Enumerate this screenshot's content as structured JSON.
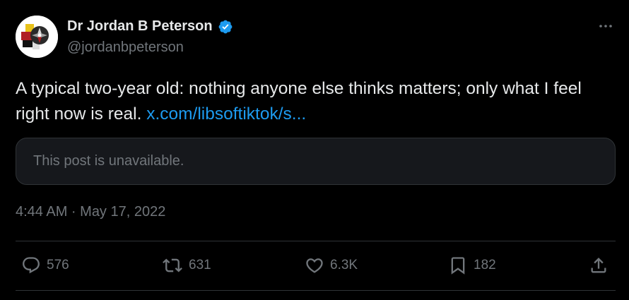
{
  "colors": {
    "background": "#000000",
    "text_primary": "#e7e9ea",
    "text_secondary": "#71767b",
    "link": "#1d9bf0",
    "verified_badge": "#1d9bf0",
    "divider": "#2f3336",
    "quote_background": "#16181c"
  },
  "author": {
    "display_name": "Dr Jordan B Peterson",
    "handle": "@jordanbpeterson",
    "verified_icon": "verified-badge-icon",
    "avatar": "profile-avatar-image"
  },
  "header": {
    "more_icon": "more-horizontal-icon"
  },
  "post": {
    "text": "A typical two-year old: nothing anyone else thinks matters; only what I feel right now is real. ",
    "link_text": "x.com/libsoftiktok/s..."
  },
  "quote": {
    "text": "This post is unavailable."
  },
  "timestamp": "4:44 AM · May 17, 2022",
  "actions": {
    "reply": {
      "icon": "reply-bubble-icon",
      "count": "576"
    },
    "repost": {
      "icon": "repost-arrows-icon",
      "count": "631"
    },
    "like": {
      "icon": "heart-icon",
      "count": "6.3K"
    },
    "bookmark": {
      "icon": "bookmark-icon",
      "count": "182"
    },
    "share": {
      "icon": "share-upload-icon"
    }
  }
}
